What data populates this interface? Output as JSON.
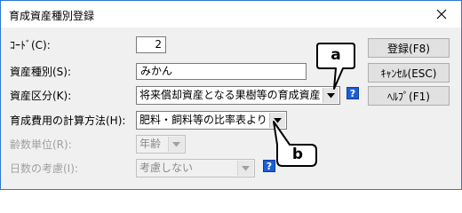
{
  "window": {
    "title": "育成資産種別登録"
  },
  "form": {
    "code_label": "ｺｰﾄﾞ(C):",
    "code_value": "2",
    "type_label": "資産種別(S):",
    "type_value": "みかん",
    "category_label": "資産区分(K):",
    "category_value": "将来償却資産となる果樹等の育成資産",
    "calc_label": "育成費用の計算方法(H):",
    "calc_value": "肥料・飼料等の比率表より",
    "age_unit_label": "齢数単位(R):",
    "age_unit_value": "年齢",
    "days_label": "日数の考慮(I):",
    "days_value": "考慮しない"
  },
  "buttons": {
    "register": "登録(F8)",
    "cancel": "ｷｬﾝｾﾙ(ESC)",
    "help": "ﾍﾙﾌﾟ(F1)"
  },
  "help_icon_text": "?",
  "callouts": {
    "a": "a",
    "b": "b"
  },
  "icons": {
    "close": "close-icon",
    "dropdown": "chevron-down-icon",
    "help": "help-icon"
  }
}
